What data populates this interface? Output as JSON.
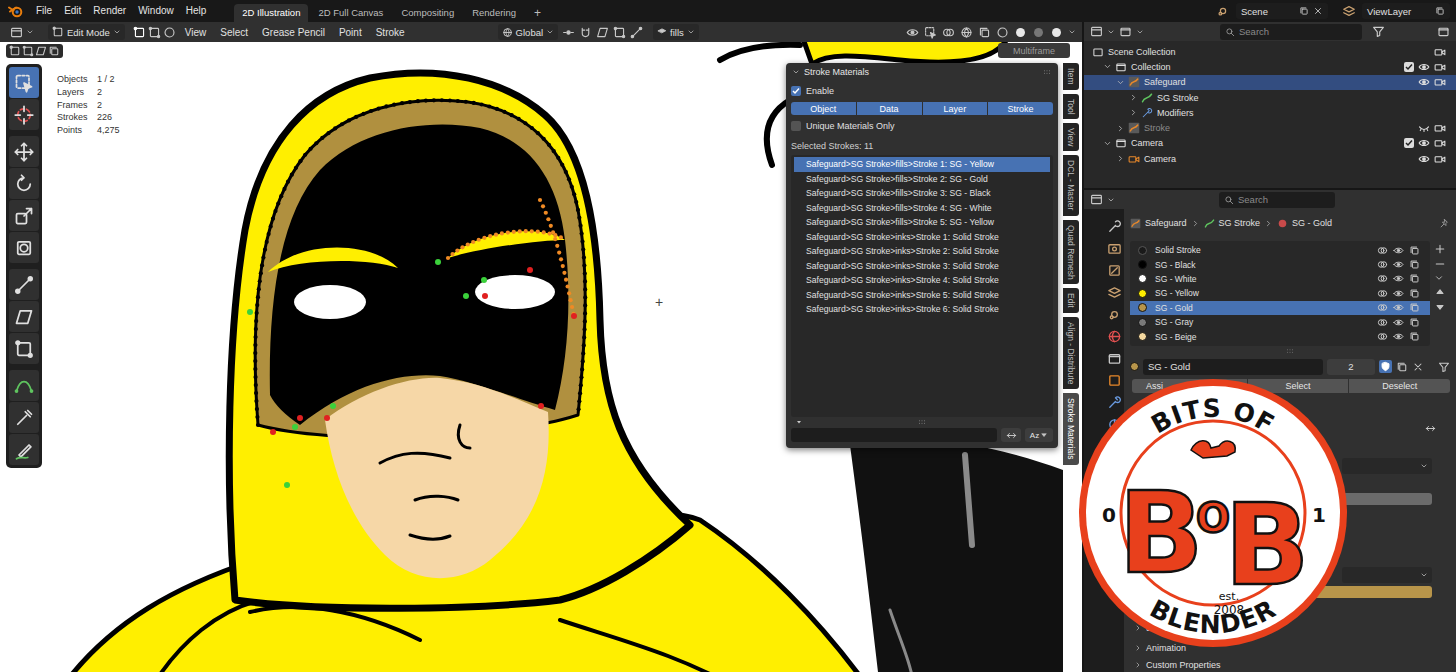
{
  "menu": [
    "File",
    "Edit",
    "Render",
    "Window",
    "Help"
  ],
  "workspaces": [
    {
      "label": "2D Illustration",
      "selected": true
    },
    {
      "label": "2D Full Canvas",
      "selected": false
    },
    {
      "label": "Compositing",
      "selected": false
    },
    {
      "label": "Rendering",
      "selected": false
    }
  ],
  "add_workspace": "+",
  "scene": "Scene",
  "view_layer": "ViewLayer",
  "viewport_header": {
    "mode": "Edit Mode",
    "menus": [
      "View",
      "Select",
      "Grease Pencil",
      "Point",
      "Stroke"
    ],
    "orientation": "Global",
    "layer": "fills",
    "multiframe": "Multiframe"
  },
  "stats": [
    {
      "label": "Objects",
      "value": "1 / 2"
    },
    {
      "label": "Layers",
      "value": "2"
    },
    {
      "label": "Frames",
      "value": "2"
    },
    {
      "label": "Strokes",
      "value": "226"
    },
    {
      "label": "Points",
      "value": "4,275"
    }
  ],
  "cursor": "+",
  "tools": [
    {
      "kind": "select-box",
      "selected": true
    },
    {
      "kind": "cursor",
      "selected": false
    },
    {
      "kind": "move",
      "selected": false
    },
    {
      "kind": "rotate",
      "selected": false
    },
    {
      "kind": "scale",
      "selected": false
    },
    {
      "kind": "transform",
      "selected": false
    },
    {
      "kind": "bend",
      "selected": false
    },
    {
      "kind": "shear",
      "selected": false
    },
    {
      "kind": "envelope",
      "selected": false
    },
    {
      "kind": "interpolate",
      "selected": false
    },
    {
      "kind": "eyedropper",
      "selected": false
    },
    {
      "kind": "annotate",
      "selected": false
    }
  ],
  "stroke_panel": {
    "title": "Stroke Materials",
    "enable": {
      "label": "Enable",
      "checked": true
    },
    "modes": [
      {
        "label": "Object",
        "selected": true
      },
      {
        "label": "Data",
        "selected": true
      },
      {
        "label": "Layer",
        "selected": true
      },
      {
        "label": "Stroke",
        "selected": true
      }
    ],
    "unique": {
      "label": "Unique Materials Only",
      "checked": false
    },
    "count": "Selected Strokes: 11",
    "strokes": [
      {
        "label": "Safeguard>SG Stroke>fills>Stroke 1: SG - Yellow",
        "selected": true
      },
      {
        "label": "Safeguard>SG Stroke>fills>Stroke 2: SG - Gold",
        "selected": false
      },
      {
        "label": "Safeguard>SG Stroke>fills>Stroke 3: SG - Black",
        "selected": false
      },
      {
        "label": "Safeguard>SG Stroke>fills>Stroke 4: SG - White",
        "selected": false
      },
      {
        "label": "Safeguard>SG Stroke>fills>Stroke 5: SG - Yellow",
        "selected": false
      },
      {
        "label": "Safeguard>SG Stroke>inks>Stroke 1: Solid Stroke",
        "selected": false
      },
      {
        "label": "Safeguard>SG Stroke>inks>Stroke 2: Solid Stroke",
        "selected": false
      },
      {
        "label": "Safeguard>SG Stroke>inks>Stroke 3: Solid Stroke",
        "selected": false
      },
      {
        "label": "Safeguard>SG Stroke>inks>Stroke 4: Solid Stroke",
        "selected": false
      },
      {
        "label": "Safeguard>SG Stroke>inks>Stroke 5: Solid Stroke",
        "selected": false
      },
      {
        "label": "Safeguard>SG Stroke>inks>Stroke 6: Solid Stroke",
        "selected": false
      }
    ],
    "sort": "Az"
  },
  "sidebar_tabs": [
    {
      "label": "Item",
      "selected": false
    },
    {
      "label": "Tool",
      "selected": false
    },
    {
      "label": "View",
      "selected": false
    },
    {
      "label": "DCL - Master",
      "selected": false
    },
    {
      "label": "Quad Remesh",
      "selected": false
    },
    {
      "label": "Edit",
      "selected": false
    },
    {
      "label": "Align - Distribute",
      "selected": false
    },
    {
      "label": "Stroke Materials",
      "selected": true
    }
  ],
  "outliner": {
    "search": "Search",
    "rows": [
      {
        "label": "Scene Collection",
        "depth": 0,
        "kind": "scene",
        "expanded": true,
        "selected": false,
        "dimmed": false
      },
      {
        "label": "Collection",
        "depth": 1,
        "kind": "collection",
        "checked": true,
        "expanded": true,
        "selected": false,
        "dimmed": false
      },
      {
        "label": "Safeguard",
        "depth": 2,
        "kind": "object",
        "expanded": true,
        "selected": true,
        "dimmed": false
      },
      {
        "label": "SG Stroke",
        "depth": 3,
        "kind": "gp-data",
        "expanded": false,
        "selected": false,
        "dimmed": false
      },
      {
        "label": "Modifiers",
        "depth": 3,
        "kind": "modifiers",
        "expanded": false,
        "selected": false,
        "dimmed": false
      },
      {
        "label": "Stroke",
        "depth": 2,
        "kind": "object",
        "expanded": false,
        "selected": false,
        "dimmed": true
      },
      {
        "label": "Camera",
        "depth": 1,
        "kind": "collection",
        "checked": true,
        "expanded": true,
        "selected": false,
        "dimmed": false
      },
      {
        "label": "Camera",
        "depth": 2,
        "kind": "camera-object",
        "expanded": false,
        "selected": false,
        "dimmed": false
      }
    ]
  },
  "properties": {
    "search": "Search",
    "breadcrumb": [
      "Safeguard",
      "SG Stroke",
      "SG - Gold"
    ],
    "tabs": [
      {
        "kind": "tool"
      },
      {
        "kind": "render"
      },
      {
        "kind": "output"
      },
      {
        "kind": "view-layer"
      },
      {
        "kind": "scene"
      },
      {
        "kind": "world"
      },
      {
        "kind": "collection"
      },
      {
        "kind": "object"
      },
      {
        "kind": "modifier"
      },
      {
        "kind": "shaderfx"
      },
      {
        "kind": "physics"
      }
    ],
    "materials": [
      {
        "name": "Solid Stroke",
        "color": "#1a1a1a",
        "selected": false
      },
      {
        "name": "SG - Black",
        "color": "#000000",
        "selected": false
      },
      {
        "name": "SG - White",
        "color": "#ffffff",
        "selected": false
      },
      {
        "name": "SG - Yellow",
        "color": "#ffee00",
        "selected": false
      },
      {
        "name": "SG - Gold",
        "color": "#b8954a",
        "selected": true
      },
      {
        "name": "SG - Gray",
        "color": "#7a7a7a",
        "selected": false
      },
      {
        "name": "SG - Beige",
        "color": "#f5d9a0",
        "selected": false
      }
    ],
    "slot": {
      "name": "SG - Gold",
      "users": "2"
    },
    "buttons": [
      "Assi",
      "Select",
      "Deselect"
    ],
    "sections": [
      "Pr",
      "Setti",
      "Animation",
      "Custom Properties"
    ]
  },
  "logo": {
    "top": "BITS OF",
    "bottom": "BLENDER",
    "letters": [
      "B",
      "O",
      "B"
    ],
    "left": "0",
    "right": "1",
    "est": "est.",
    "year": "2008"
  }
}
